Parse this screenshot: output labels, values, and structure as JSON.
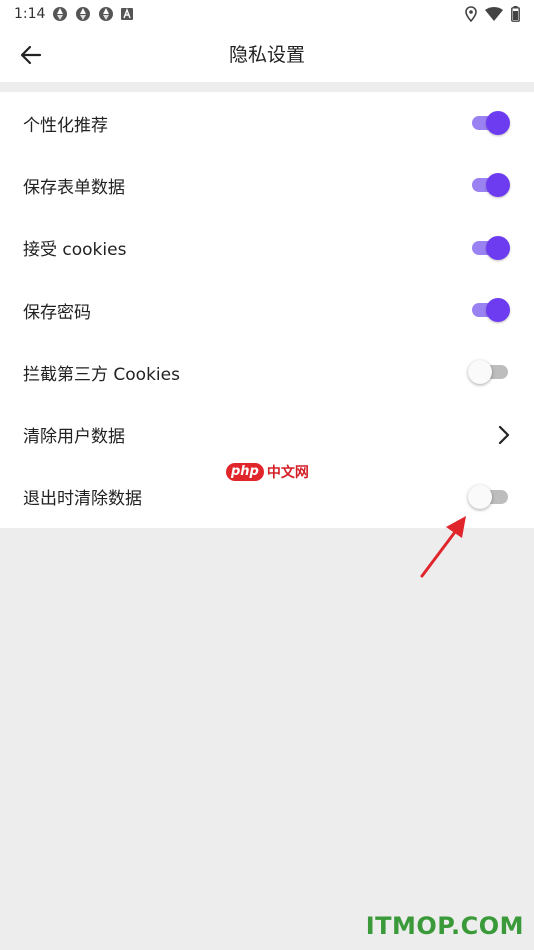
{
  "status_bar": {
    "time": "1:14",
    "left_icons": [
      "aperture-icon",
      "aperture-icon",
      "aperture-icon",
      "a-box-icon"
    ],
    "right_icons": [
      "location-icon",
      "wifi-icon",
      "battery-icon"
    ]
  },
  "app_bar": {
    "title": "隐私设置",
    "back_icon": "arrow-left-icon"
  },
  "settings": [
    {
      "label": "个性化推荐",
      "control": "switch",
      "on": true
    },
    {
      "label": "保存表单数据",
      "control": "switch",
      "on": true
    },
    {
      "label": "接受 cookies",
      "control": "switch",
      "on": true
    },
    {
      "label": "保存密码",
      "control": "switch",
      "on": true
    },
    {
      "label": "拦截第三方 Cookies",
      "control": "switch",
      "on": false
    },
    {
      "label": "清除用户数据",
      "control": "chevron"
    },
    {
      "label": "退出时清除数据",
      "control": "switch",
      "on": false
    }
  ],
  "colors": {
    "accent": "#6e3cf0",
    "accent_track": "#9b82f3",
    "off_track": "#bdbdbd",
    "page_bg": "#ededed",
    "annotation": "#e0262b"
  },
  "watermarks": {
    "php_badge": "php",
    "php_text": "中文网",
    "site": "ITMOP.COM"
  }
}
